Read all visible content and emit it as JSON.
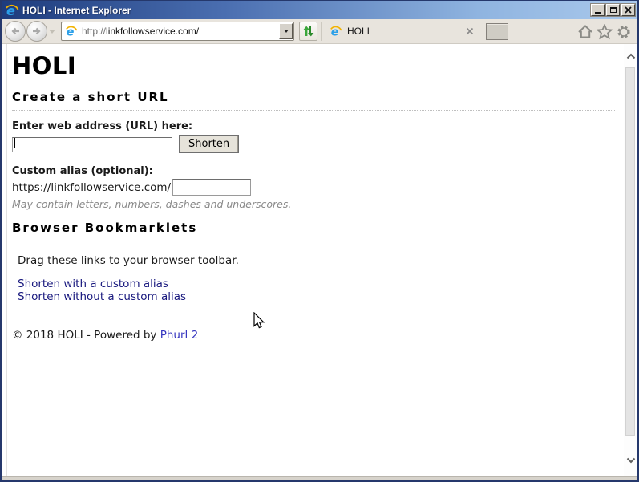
{
  "titlebar": {
    "title": "HOLI - Internet Explorer"
  },
  "toolbar": {
    "address": {
      "protocol": "http://",
      "domain": "linkfollowservice.com/"
    },
    "tab": {
      "label": "HOLI"
    }
  },
  "page": {
    "heading": "HOLI",
    "create": {
      "heading": "Create a short URL",
      "url_label": "Enter web address (URL) here:",
      "url_value": "",
      "shorten_label": "Shorten",
      "alias_label": "Custom alias (optional):",
      "alias_prefix": "https://linkfollowservice.com/",
      "alias_value": "",
      "hint": "May contain letters, numbers, dashes and underscores."
    },
    "bookmarklets": {
      "heading": "Browser Bookmarklets",
      "intro": "Drag these links to your browser toolbar.",
      "links": [
        {
          "label": "Shorten with a custom alias"
        },
        {
          "label": "Shorten without a custom alias"
        }
      ]
    },
    "footer": {
      "prefix": "© 2018 HOLI - Powered by ",
      "link_label": "Phurl 2"
    }
  },
  "icons": {
    "ie-logo": "blue-e-with-gold-arc",
    "minimize": "underscore-bar",
    "maximize": "square",
    "close": "x",
    "back": "left-arrow-circle-disabled",
    "forward": "right-arrow-circle-disabled",
    "nav-dropdown": "down-triangle",
    "address-dropdown": "down-triangle",
    "refresh": "green-up-down-arrows",
    "tab-close": "x",
    "home": "house-outline",
    "favorites": "star-outline",
    "settings": "gear-outline",
    "scroll-up": "chevron-up",
    "scroll-down": "chevron-down"
  },
  "colors": {
    "titlebar_left": "#1e3c7d",
    "titlebar_right": "#aac9ec",
    "toolbar_bg": "#e8e4dd",
    "link_navy": "#18187e",
    "footer_link_blue": "#3434bf",
    "hint_gray": "#898989",
    "refresh_green": "#2f9a2f"
  }
}
